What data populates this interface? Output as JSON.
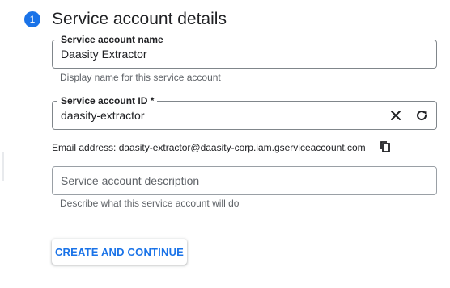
{
  "step": {
    "number": "1",
    "title": "Service account details"
  },
  "fields": {
    "name": {
      "label": "Service account name",
      "value": "Daasity Extractor",
      "hint": "Display name for this service account"
    },
    "id": {
      "label": "Service account ID *",
      "value": "daasity-extractor",
      "clear_icon": "close-icon",
      "refresh_icon": "refresh-icon"
    },
    "email": {
      "text": "Email address: daasity-extractor@daasity-corp.iam.gserviceaccount.com",
      "copy_icon": "copy-icon"
    },
    "description": {
      "placeholder": "Service account description",
      "hint": "Describe what this service account will do"
    }
  },
  "actions": {
    "create_label": "CREATE AND CONTINUE"
  },
  "colors": {
    "accent": "#1a73e8",
    "text": "#202124",
    "muted": "#5f6368",
    "border": "#80868b"
  }
}
